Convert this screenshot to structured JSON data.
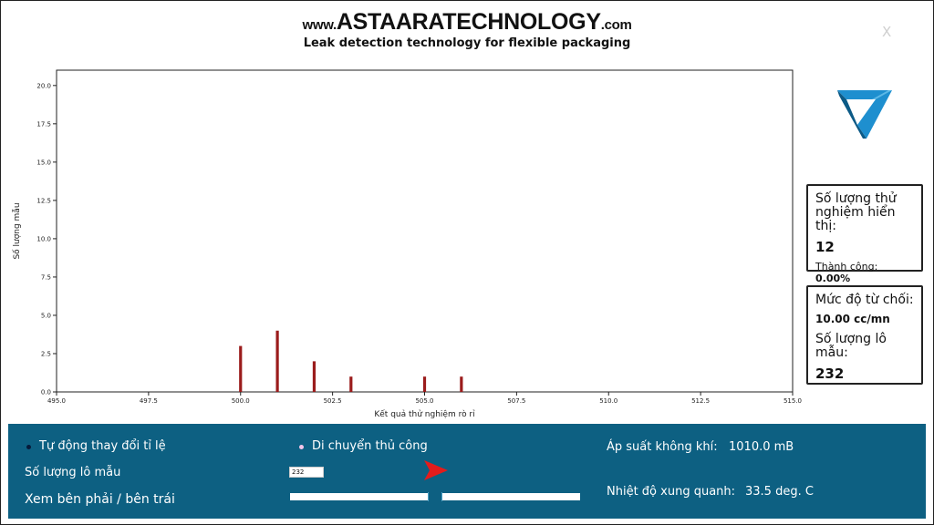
{
  "header": {
    "brand_www": "www.",
    "brand_main": "ASTAARATECHNOLOGY",
    "brand_com": ".com",
    "tagline": "Leak detection technology for flexible packaging",
    "close_label": "X"
  },
  "stats": {
    "tests_label": "Số lượng thử nghiệm hiển thị:",
    "tests_value": "12",
    "success_label": "Thành công: ",
    "success_value": "0.00%",
    "reject_label": "Mức độ từ chối:",
    "reject_value": "10.00 cc/mn",
    "batch_label": "Số lượng lô mẫu:",
    "batch_value": "232"
  },
  "controls": {
    "auto_scale_label": "Tự động thay đổi tỉ lệ",
    "manual_move_label": "Di chuyển thủ công",
    "batch_size_label": "Số lượng lô mẫu",
    "batch_input_value": "232",
    "view_label": "Xem bên phải / bên trái",
    "pressure_label": "Áp suất không khí:",
    "pressure_value": "1010.0 mB",
    "temp_label": "Nhiệt độ xung quanh:",
    "temp_value": "33.5 deg. C"
  },
  "colors": {
    "panel_bg": "#0d6082",
    "bar_color": "#9b1c1c",
    "arrow_color": "#e31c1c",
    "logo_blue": "#1e8fcf"
  },
  "chart_data": {
    "type": "bar",
    "xlabel": "Kết quả thử nghiệm rò rỉ",
    "ylabel": "Số lượng mẫu",
    "xlim": [
      495.0,
      515.0
    ],
    "ylim": [
      0,
      21
    ],
    "xticks": [
      "495.0",
      "497.5",
      "500.0",
      "502.5",
      "505.0",
      "507.5",
      "510.0",
      "512.5",
      "515.0"
    ],
    "yticks": [
      "0.0",
      "2.5",
      "5.0",
      "7.5",
      "10.0",
      "12.5",
      "15.0",
      "17.5",
      "20.0"
    ],
    "x": [
      500,
      501,
      502,
      503,
      505,
      506
    ],
    "values": [
      3,
      4,
      2,
      1,
      1,
      1
    ],
    "grid": false
  }
}
